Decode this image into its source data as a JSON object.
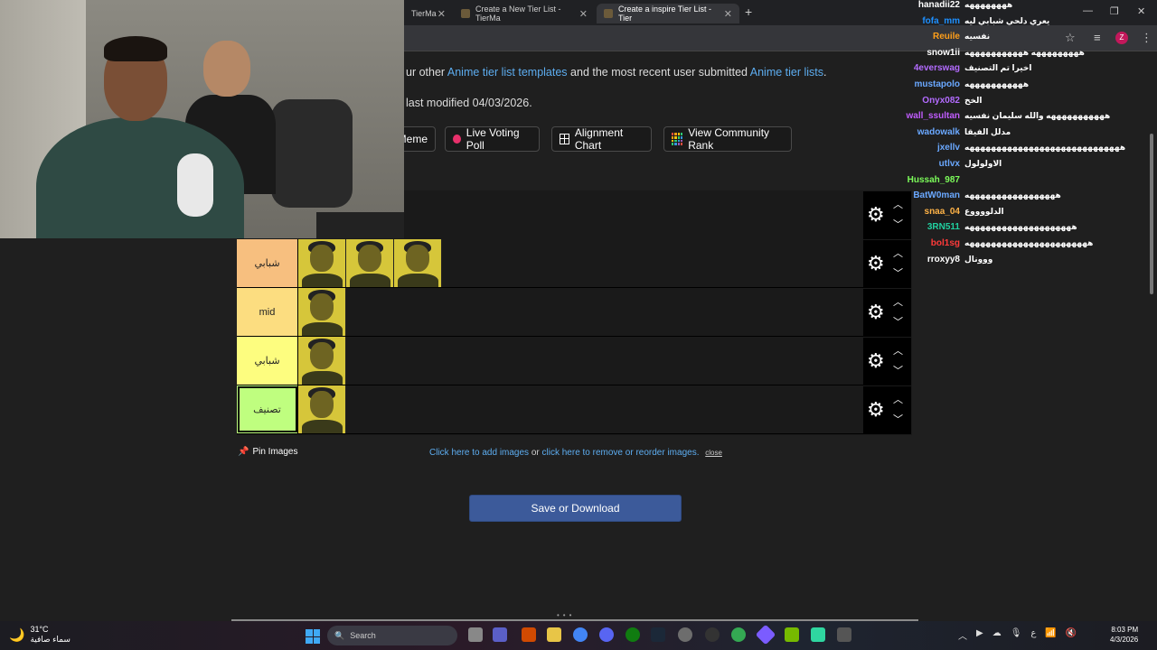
{
  "browser": {
    "tabs": [
      {
        "title": "TierMa",
        "active": false
      },
      {
        "title": "Create a New Tier List - TierMa",
        "active": false
      },
      {
        "title": "Create a inspire Tier List - Tier",
        "active": true
      }
    ],
    "new_tab": "+",
    "window_controls": [
      "—",
      "❐",
      "✕"
    ]
  },
  "page": {
    "intro": {
      "prefix": "ur other ",
      "link1": "Anime tier list templates",
      "middle": " and the most recent user submitted ",
      "link2": "Anime tier lists",
      "suffix": "."
    },
    "modified": "last modified 04/03/2026.",
    "buttons": [
      {
        "label": "Meme"
      },
      {
        "label": "Live Voting Poll"
      },
      {
        "label": "Alignment Chart"
      },
      {
        "label": "View Community Rank"
      }
    ],
    "tiers": [
      {
        "label": "شبابي",
        "color": "#f7bf7f",
        "items": 3
      },
      {
        "label": "mid",
        "color": "#fcdd80",
        "items": 1
      },
      {
        "label": "شبابي",
        "color": "#fdfd7f",
        "items": 1
      },
      {
        "label": "تصنيف",
        "color": "#bffe7f",
        "items": 1
      }
    ],
    "pin_images": "Pin Images",
    "add_images": {
      "link1": "Click here to add images",
      "or": " or ",
      "link2": "click here to remove or reorder images.",
      "close": "close"
    },
    "save_button": "Save or Download"
  },
  "chat": [
    {
      "user": "hanadii22",
      "color": "#ffffff",
      "msg": "ههههههههه"
    },
    {
      "user": "fofa_mm",
      "color": "#1e90ff",
      "msg": "يعري دلحي شبابي ليه"
    },
    {
      "user": "Reuile",
      "color": "#ff9f1a",
      "msg": "نفسيه"
    },
    {
      "user": "snow1ii",
      "color": "#ffffff",
      "msg": "هههههههههه هههههههههههه"
    },
    {
      "user": "4everswag",
      "color": "#b36bff",
      "msg": "اخيرا تم التصنيف"
    },
    {
      "user": "mustapolo",
      "color": "#6aa8ff",
      "msg": "هههههههههههه"
    },
    {
      "user": "Onyx082",
      "color": "#b36bff",
      "msg": "الخخ"
    },
    {
      "user": "wall_ssultan",
      "color": "#c15cff",
      "msg": "هههههههههههه والله سليمان نفسيه"
    },
    {
      "user": "wadowalk",
      "color": "#6aa8ff",
      "msg": "مدلل الفيقا"
    },
    {
      "user": "jxellv",
      "color": "#6aa8ff",
      "msg": "هههههههههههههههههههههههههههههه"
    },
    {
      "user": "utlvx",
      "color": "#6aa8ff",
      "msg": "الاولولول"
    },
    {
      "user": "Hussah_987",
      "color": "#7cfc5a",
      "msg": ""
    },
    {
      "user": "BatW0man",
      "color": "#6aa8ff",
      "msg": "هههههههههههههههههه"
    },
    {
      "user": "snaa_04",
      "color": "#ffb347",
      "msg": "الدلووووع"
    },
    {
      "user": "3RN511",
      "color": "#20d0a0",
      "msg": "ههههههههههههههههههههه"
    },
    {
      "user": "bol1sg",
      "color": "#ff3a3a",
      "msg": "هههههههههههههههههههههههه"
    },
    {
      "user": "rroxyy8",
      "color": "#ffffff",
      "msg": "ووونال"
    }
  ],
  "taskbar": {
    "weather_temp": "31°C",
    "weather_desc": "سماء صافية",
    "search_placeholder": "Search",
    "time": "8:03 PM",
    "date": "4/3/2026",
    "lang": "ع"
  },
  "colors": {
    "link": "#5dadf0",
    "save_button": "#3c5a9a"
  }
}
